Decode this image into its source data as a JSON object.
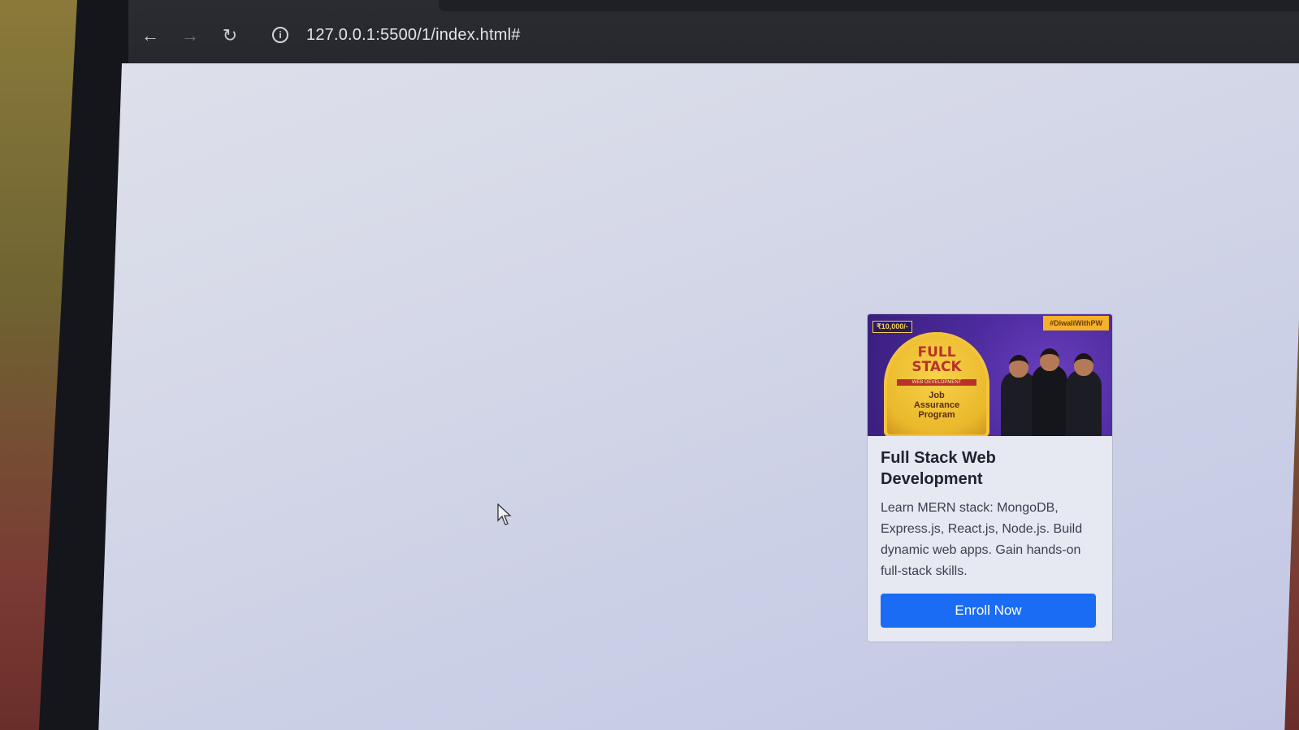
{
  "browser": {
    "url": "127.0.0.1:5500/1/index.html#",
    "back_icon": "arrow-left-icon",
    "forward_icon": "arrow-right-icon",
    "reload_icon": "reload-icon",
    "info_icon": "info-icon",
    "back_glyph": "←",
    "forward_glyph": "→",
    "reload_glyph": "↻",
    "info_glyph": "i"
  },
  "card": {
    "image": {
      "price_badge": "₹10,000/-",
      "hashtag": "#DiwaliWithPW",
      "headline": "FULL\nSTACK",
      "subhead": "WEB DEVELOPMENT",
      "program": "Job\nAssurance\nProgram"
    },
    "title": "Full Stack Web Development",
    "description": "Learn MERN stack: MongoDB, Express.js, React.js, Node.js. Build dynamic web apps. Gain hands-on full-stack skills.",
    "button_label": "Enroll Now"
  },
  "colors": {
    "button": "#1a6cf5",
    "page_background": "#d4d7e8",
    "browser_bar": "#2a2c32"
  }
}
